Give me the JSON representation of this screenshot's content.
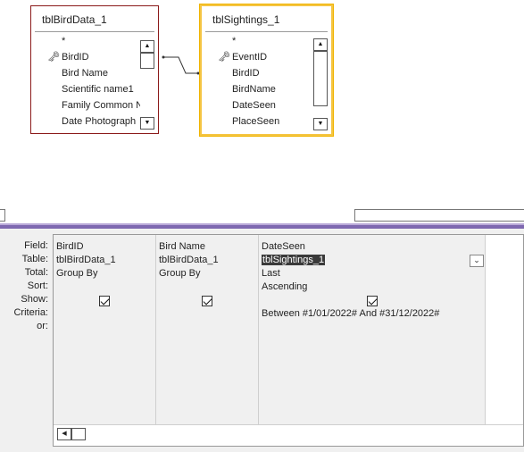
{
  "tables": [
    {
      "title": "tblBirdData_1",
      "fields": [
        {
          "label": "*",
          "key": false
        },
        {
          "label": "BirdID",
          "key": true
        },
        {
          "label": "Bird Name",
          "key": false
        },
        {
          "label": "Scientific name1",
          "key": false
        },
        {
          "label": "Family Common N",
          "key": false
        },
        {
          "label": "Date Photograph",
          "key": false
        }
      ]
    },
    {
      "title": "tblSightings_1",
      "fields": [
        {
          "label": "*",
          "key": false
        },
        {
          "label": "EventID",
          "key": true
        },
        {
          "label": "BirdID",
          "key": false
        },
        {
          "label": "BirdName",
          "key": false
        },
        {
          "label": "DateSeen",
          "key": false
        },
        {
          "label": "PlaceSeen",
          "key": false
        }
      ]
    }
  ],
  "grid": {
    "row_labels": [
      "Field:",
      "Table:",
      "Total:",
      "Sort:",
      "Show:",
      "Criteria:",
      "or:"
    ],
    "columns": [
      {
        "field": "BirdID",
        "table": "tblBirdData_1",
        "total": "Group By",
        "sort": "",
        "show": true,
        "criteria": ""
      },
      {
        "field": "Bird Name",
        "table": "tblBirdData_1",
        "total": "Group By",
        "sort": "",
        "show": true,
        "criteria": ""
      },
      {
        "field": "DateSeen",
        "table": "tblSightings_1",
        "total": "Last",
        "sort": "Ascending",
        "show": true,
        "criteria": "Between #1/01/2022# And #31/12/2022#"
      }
    ]
  },
  "icons": {
    "key": "primary-key-icon",
    "scroll_up": "scroll-up-arrow-icon",
    "scroll_down": "scroll-down-arrow-icon",
    "scroll_left": "scroll-left-arrow-icon",
    "dropdown": "chevron-down-icon"
  },
  "colors": {
    "table_border": "#8b1a1a",
    "selected_table_border": "#f5c542",
    "splitter": "#7e68b0"
  }
}
